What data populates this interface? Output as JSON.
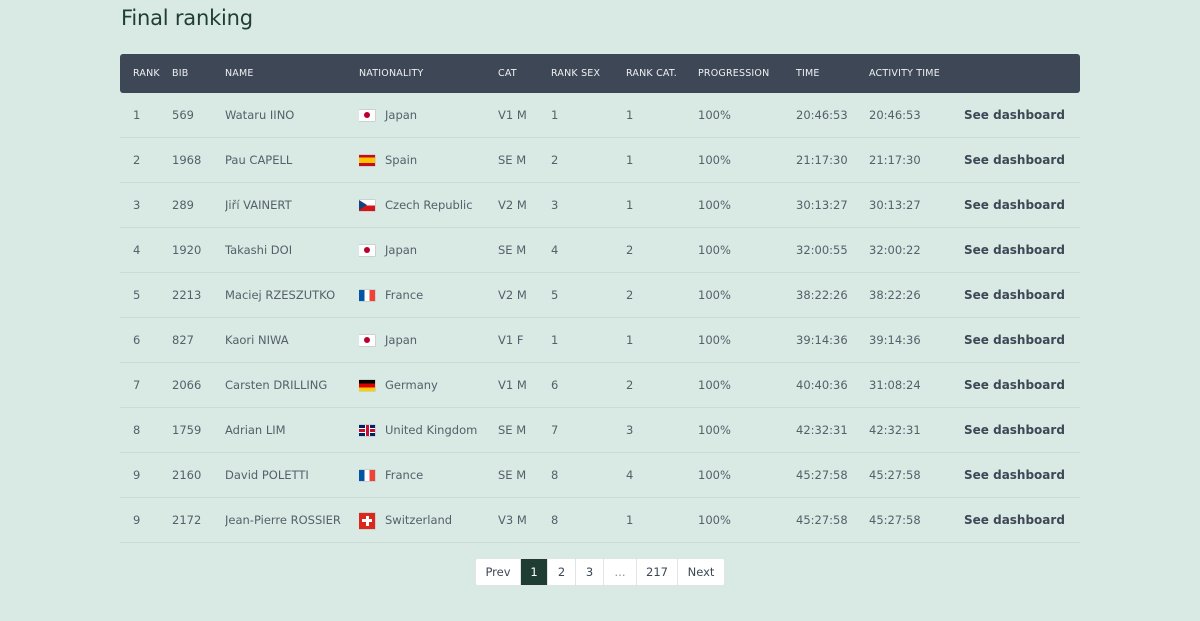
{
  "page": {
    "title": "Final ranking"
  },
  "table": {
    "headers": [
      "RANK",
      "BIB",
      "NAME",
      "NATIONALITY",
      "CAT",
      "RANK SEX",
      "RANK CAT.",
      "PROGRESSION",
      "TIME",
      "ACTIVITY TIME",
      ""
    ],
    "dashboard_label": "See dashboard",
    "rows": [
      {
        "rank": "1",
        "bib": "569",
        "name": "Wataru IINO",
        "flag": "jp",
        "nationality": "Japan",
        "cat": "V1 M",
        "rank_sex": "1",
        "rank_cat": "1",
        "progression": "100%",
        "time": "20:46:53",
        "activity_time": "20:46:53"
      },
      {
        "rank": "2",
        "bib": "1968",
        "name": "Pau CAPELL",
        "flag": "es",
        "nationality": "Spain",
        "cat": "SE M",
        "rank_sex": "2",
        "rank_cat": "1",
        "progression": "100%",
        "time": "21:17:30",
        "activity_time": "21:17:30"
      },
      {
        "rank": "3",
        "bib": "289",
        "name": "Jiří VAINERT",
        "flag": "cz",
        "nationality": "Czech Republic",
        "cat": "V2 M",
        "rank_sex": "3",
        "rank_cat": "1",
        "progression": "100%",
        "time": "30:13:27",
        "activity_time": "30:13:27"
      },
      {
        "rank": "4",
        "bib": "1920",
        "name": "Takashi DOI",
        "flag": "jp",
        "nationality": "Japan",
        "cat": "SE M",
        "rank_sex": "4",
        "rank_cat": "2",
        "progression": "100%",
        "time": "32:00:55",
        "activity_time": "32:00:22"
      },
      {
        "rank": "5",
        "bib": "2213",
        "name": "Maciej RZESZUTKO",
        "flag": "fr",
        "nationality": "France",
        "cat": "V2 M",
        "rank_sex": "5",
        "rank_cat": "2",
        "progression": "100%",
        "time": "38:22:26",
        "activity_time": "38:22:26"
      },
      {
        "rank": "6",
        "bib": "827",
        "name": "Kaori NIWA",
        "flag": "jp",
        "nationality": "Japan",
        "cat": "V1 F",
        "rank_sex": "1",
        "rank_cat": "1",
        "progression": "100%",
        "time": "39:14:36",
        "activity_time": "39:14:36"
      },
      {
        "rank": "7",
        "bib": "2066",
        "name": "Carsten DRILLING",
        "flag": "de",
        "nationality": "Germany",
        "cat": "V1 M",
        "rank_sex": "6",
        "rank_cat": "2",
        "progression": "100%",
        "time": "40:40:36",
        "activity_time": "31:08:24"
      },
      {
        "rank": "8",
        "bib": "1759",
        "name": "Adrian LIM",
        "flag": "gb",
        "nationality": "United Kingdom",
        "cat": "SE M",
        "rank_sex": "7",
        "rank_cat": "3",
        "progression": "100%",
        "time": "42:32:31",
        "activity_time": "42:32:31"
      },
      {
        "rank": "9",
        "bib": "2160",
        "name": "David POLETTI",
        "flag": "fr",
        "nationality": "France",
        "cat": "SE M",
        "rank_sex": "8",
        "rank_cat": "4",
        "progression": "100%",
        "time": "45:27:58",
        "activity_time": "45:27:58"
      },
      {
        "rank": "9",
        "bib": "2172",
        "name": "Jean-Pierre ROSSIER",
        "flag": "ch",
        "nationality": "Switzerland",
        "cat": "V3 M",
        "rank_sex": "8",
        "rank_cat": "1",
        "progression": "100%",
        "time": "45:27:58",
        "activity_time": "45:27:58"
      }
    ]
  },
  "pagination": {
    "prev": "Prev",
    "pages": [
      "1",
      "2",
      "3"
    ],
    "ellipsis": "...",
    "last": "217",
    "next": "Next",
    "active": "1"
  }
}
